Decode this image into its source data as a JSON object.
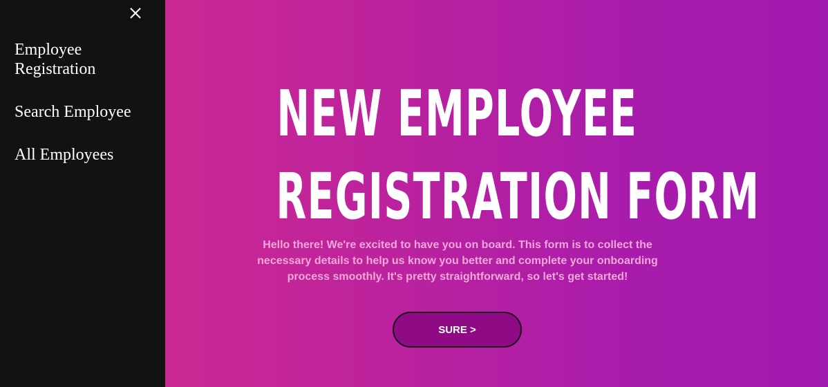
{
  "sidebar": {
    "close_icon": "close-icon",
    "items": [
      {
        "label": "Employee Registration"
      },
      {
        "label": "Search Employee"
      },
      {
        "label": "All Employees"
      }
    ]
  },
  "main": {
    "title_line1": "NEW EMPLOYEE",
    "title_line2": "REGISTRATION FORM",
    "intro": "Hello there! We're excited to have you on board. This form is to collect the necessary details to help us know you better and complete your onboarding process smoothly. It's pretty straightforward, so let's get started!",
    "button_label": "SURE >"
  },
  "colors": {
    "sidebar_bg": "#121212",
    "gradient_start": "#d42b8c",
    "gradient_end": "#a11aaf",
    "button_bg": "#8f0b86",
    "intro_text": "#f0a8d8"
  }
}
